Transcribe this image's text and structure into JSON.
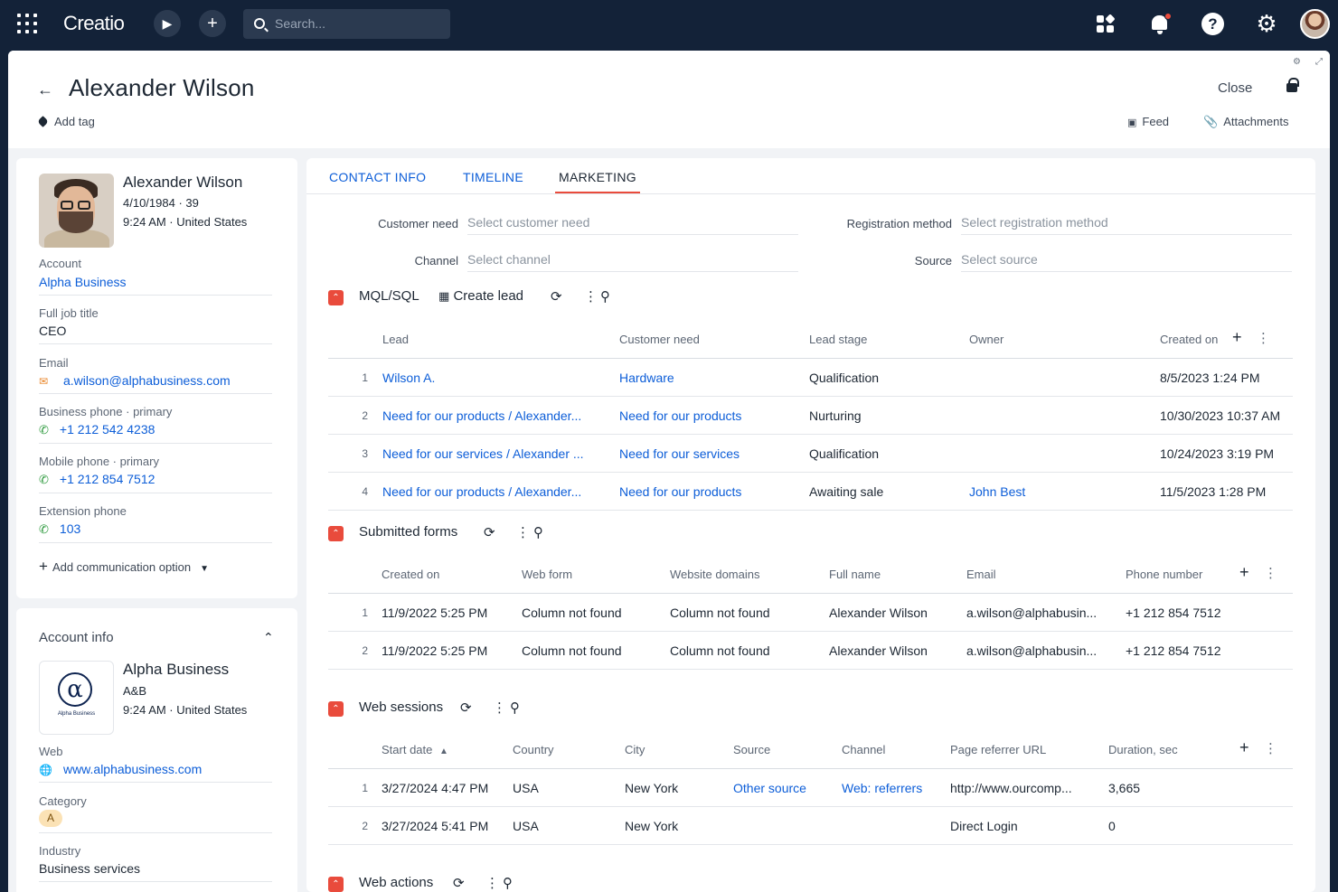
{
  "app": {
    "brand": "Creatio",
    "search_placeholder": "Search..."
  },
  "header": {
    "title": "Alexander Wilson",
    "add_tag": "Add tag",
    "close": "Close",
    "feed": "Feed",
    "attachments": "Attachments"
  },
  "profile": {
    "name": "Alexander Wilson",
    "dob": "4/10/1984 · 39",
    "time_loc": "9:24 AM · United States",
    "fields": [
      {
        "label": "Account",
        "value": "Alpha Business"
      },
      {
        "label": "Full job title",
        "value": "CEO"
      },
      {
        "label": "Email",
        "value": "a.wilson@alphabusiness.com"
      },
      {
        "label": "Business phone · primary",
        "value": "+1 212 542 4238"
      },
      {
        "label": "Mobile phone · primary",
        "value": "+1 212 854 7512"
      },
      {
        "label": "Extension phone",
        "value": "103"
      }
    ],
    "add_comm": "Add communication option"
  },
  "account_info": {
    "section_title": "Account info",
    "name": "Alpha Business",
    "code": "A&B",
    "time_loc": "9:24 AM · United States",
    "logo_caption": "Alpha Business",
    "fields": [
      {
        "label": "Web",
        "value": "www.alphabusiness.com"
      },
      {
        "label": "Category",
        "value": "A"
      },
      {
        "label": "Industry",
        "value": "Business services"
      }
    ]
  },
  "tabs": [
    "CONTACT INFO",
    "TIMELINE",
    "MARKETING"
  ],
  "marketing_fields": {
    "customer_need": {
      "label": "Customer need",
      "placeholder": "Select customer need"
    },
    "registration_method": {
      "label": "Registration method",
      "placeholder": "Select registration method"
    },
    "channel": {
      "label": "Channel",
      "placeholder": "Select channel"
    },
    "source": {
      "label": "Source",
      "placeholder": "Select source"
    }
  },
  "mql": {
    "title": "MQL/SQL",
    "create_lead": "Create lead",
    "columns": [
      "Lead",
      "Customer need",
      "Lead stage",
      "Owner",
      "Created on"
    ],
    "rows": [
      {
        "n": "1",
        "lead": "Wilson A.",
        "need": "Hardware",
        "stage": "Qualification",
        "owner": "",
        "created": "8/5/2023 1:24 PM"
      },
      {
        "n": "2",
        "lead": "Need for our products / Alexander...",
        "need": "Need for our products",
        "stage": "Nurturing",
        "owner": "",
        "created": "10/30/2023 10:37 AM"
      },
      {
        "n": "3",
        "lead": "Need for our services / Alexander ...",
        "need": "Need for our services",
        "stage": "Qualification",
        "owner": "",
        "created": "10/24/2023 3:19 PM"
      },
      {
        "n": "4",
        "lead": "Need for our products / Alexander...",
        "need": "Need for our products",
        "stage": "Awaiting sale",
        "owner": "John Best",
        "created": "11/5/2023 1:28 PM"
      }
    ]
  },
  "forms": {
    "title": "Submitted forms",
    "columns": [
      "Created on",
      "Web form",
      "Website domains",
      "Full name",
      "Email",
      "Phone number"
    ],
    "rows": [
      {
        "n": "1",
        "created": "11/9/2022 5:25 PM",
        "form": "Column not found",
        "domains": "Column not found",
        "name": "Alexander Wilson",
        "email": "a.wilson@alphabusin...",
        "phone": "+1 212 854 7512"
      },
      {
        "n": "2",
        "created": "11/9/2022 5:25 PM",
        "form": "Column not found",
        "domains": "Column not found",
        "name": "Alexander Wilson",
        "email": "a.wilson@alphabusin...",
        "phone": "+1 212 854 7512"
      }
    ]
  },
  "sessions": {
    "title": "Web sessions",
    "columns": [
      "Start date",
      "Country",
      "City",
      "Source",
      "Channel",
      "Page referrer URL",
      "Duration, sec"
    ],
    "rows": [
      {
        "n": "1",
        "start": "3/27/2024 4:47 PM",
        "country": "USA",
        "city": "New York",
        "source": "Other source",
        "channel": "Web: referrers",
        "url": "http://www.ourcomp...",
        "duration": "3,665"
      },
      {
        "n": "2",
        "start": "3/27/2024 5:41 PM",
        "country": "USA",
        "city": "New York",
        "source": "",
        "channel": "",
        "url": "Direct Login",
        "duration": "0"
      }
    ]
  },
  "actions": {
    "title": "Web actions"
  },
  "colors": {
    "accent": "#e94b3c",
    "link": "#0d5ed8",
    "topbar": "#132238"
  }
}
